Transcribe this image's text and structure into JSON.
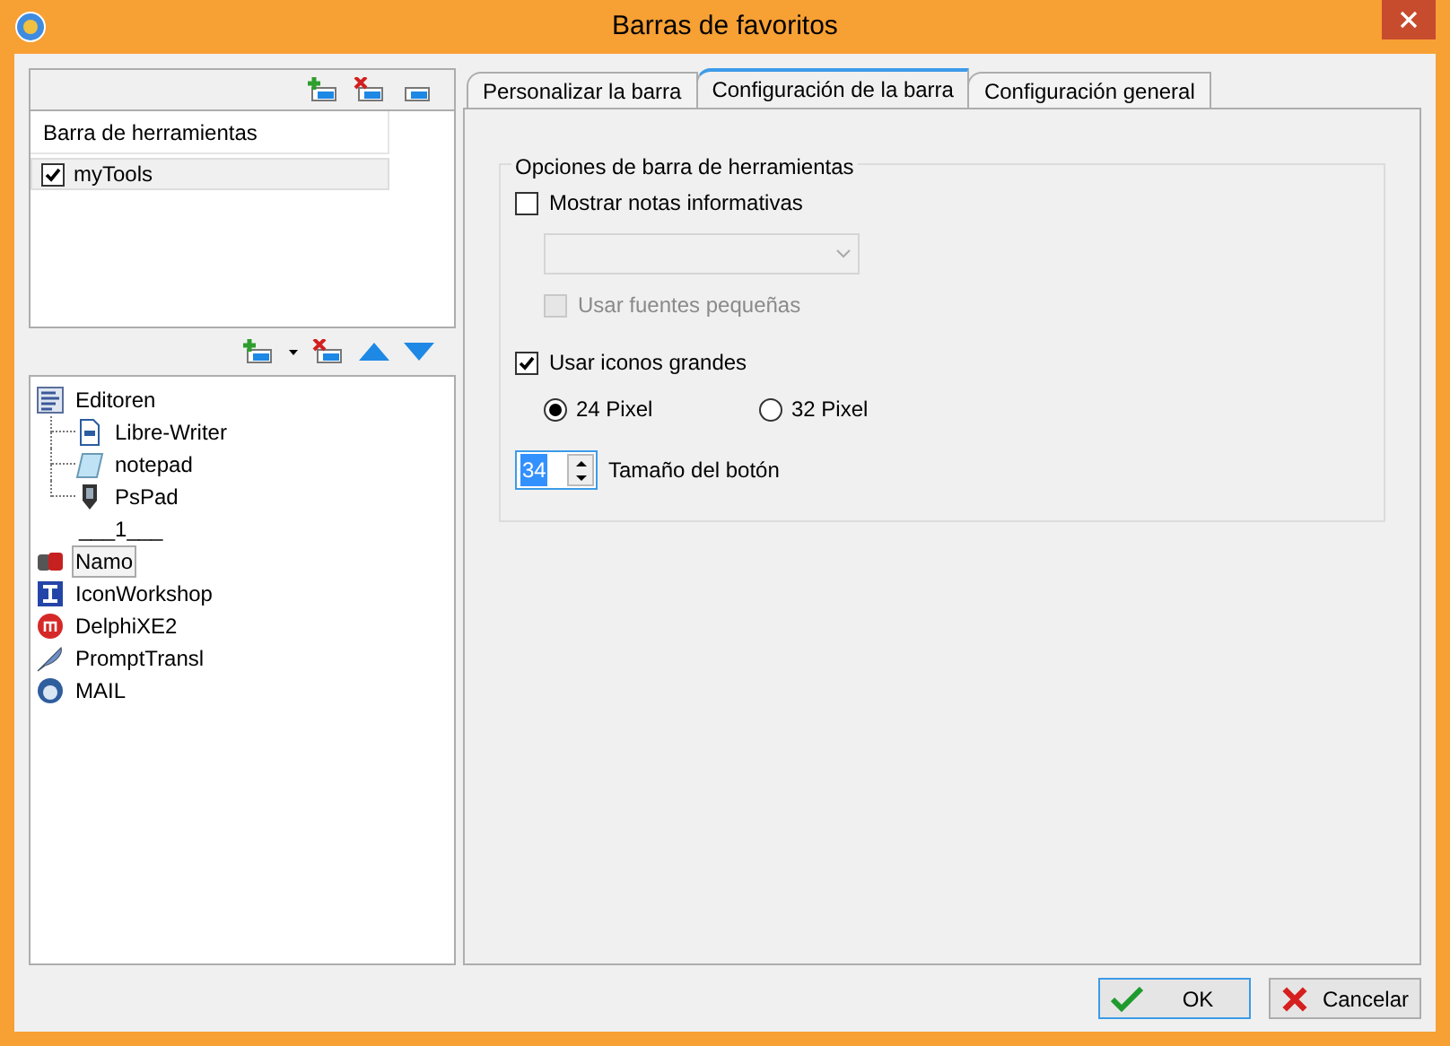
{
  "window": {
    "title": "Barras de favoritos"
  },
  "toolbars_list": {
    "header": "Barra de herramientas",
    "items": [
      {
        "label": "myTools",
        "checked": true
      }
    ]
  },
  "tree": [
    {
      "label": "Editoren",
      "kind": "folder",
      "selected": false,
      "expanded": true,
      "children": [
        {
          "label": "Libre-Writer",
          "kind": "writer",
          "selected": false
        },
        {
          "label": "notepad",
          "kind": "notepad",
          "selected": false
        },
        {
          "label": "PsPad",
          "kind": "pen",
          "selected": false
        }
      ]
    },
    {
      "label": "___1___",
      "kind": "separator",
      "selected": false
    },
    {
      "label": "Namo",
      "kind": "namo",
      "selected": true
    },
    {
      "label": "IconWorkshop",
      "kind": "iw",
      "selected": false
    },
    {
      "label": "DelphiXE2",
      "kind": "delphi",
      "selected": false
    },
    {
      "label": "PromptTransl",
      "kind": "quill",
      "selected": false
    },
    {
      "label": "MAIL",
      "kind": "mail",
      "selected": false
    }
  ],
  "tabs": [
    {
      "label": "Personalizar la barra",
      "selected": false
    },
    {
      "label": "Configuración de la barra",
      "selected": true
    },
    {
      "label": "Configuración general",
      "selected": false
    }
  ],
  "group": {
    "title": "Opciones de barra de herramientas",
    "show_tips": {
      "label": "Mostrar notas informativas",
      "checked": false
    },
    "tips_dropdown": {
      "disabled": true
    },
    "small_fonts": {
      "label": "Usar fuentes pequeñas",
      "checked": false,
      "disabled": true
    },
    "large_icons": {
      "label": "Usar iconos grandes",
      "checked": true
    },
    "sizes": [
      {
        "label": "24 Pixel",
        "selected": true
      },
      {
        "label": "32 Pixel",
        "selected": false
      }
    ],
    "button_size": {
      "value": "34",
      "label": "Tamaño del botón"
    }
  },
  "buttons": [
    {
      "label": "OK",
      "kind": "ok"
    },
    {
      "label": "Cancelar",
      "kind": "cancel"
    }
  ]
}
